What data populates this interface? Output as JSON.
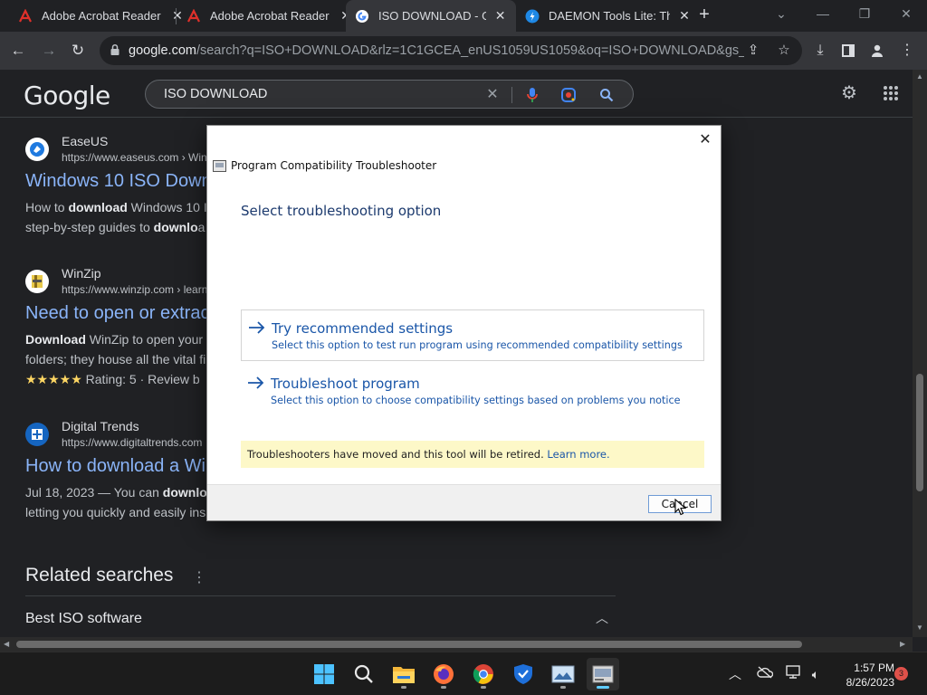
{
  "browser": {
    "tabs": [
      {
        "title": "Adobe Acrobat Reader",
        "icon": "adobe-icon"
      },
      {
        "title": "Adobe Acrobat Reader",
        "icon": "adobe-icon"
      },
      {
        "title": "ISO DOWNLOAD - Goo",
        "icon": "google-icon"
      },
      {
        "title": "DAEMON Tools Lite: Th",
        "icon": "daemon-tools-icon"
      }
    ],
    "active_tab": 2,
    "url_host": "google.com",
    "url_path": "/search?q=ISO+DOWNLOAD&rlz=1C1GCEA_enUS1059US1059&oq=ISO+DOWNLOAD&gs_lcr..."
  },
  "google": {
    "logo": "Google",
    "query": "ISO DOWNLOAD"
  },
  "results": [
    {
      "site": "EaseUS",
      "url": "https://www.easeus.com › Win",
      "title": "Windows 10 ISO Down",
      "snippet_l1_pre": "How to ",
      "snippet_l1_bold": "download",
      "snippet_l1_post": " Windows 10 I",
      "snippet_l2_pre": "step-by-step guides to ",
      "snippet_l2_bold": "downlo",
      "snippet_l2_post": "a"
    },
    {
      "site": "WinZip",
      "url": "https://www.winzip.com › learn",
      "title": "Need to open or extrac",
      "snippet_l1_pre": "",
      "snippet_l1_bold": "Download",
      "snippet_l1_post": " WinZip to open your",
      "snippet_l2_pre": "folders; they house all the vital fi",
      "snippet_l2_bold": "",
      "snippet_l2_post": "",
      "stars": "★★★★★",
      "rating": " Rating: 5 · Review b"
    },
    {
      "site": "Digital Trends",
      "url": "https://www.digitaltrends.com",
      "title": "How to download a Wi",
      "snippet_l1_pre": "Jul 18, 2023 — You can ",
      "snippet_l1_bold": "downlo",
      "snippet_l1_post": "",
      "snippet_l2_pre": "letting you quickly and easily ins",
      "snippet_l2_bold": "",
      "snippet_l2_post": ""
    }
  ],
  "related": {
    "title": "Related searches",
    "items": [
      "Best ISO software"
    ]
  },
  "dialog": {
    "title": "Program Compatibility Troubleshooter",
    "heading": "Select troubleshooting option",
    "options": [
      {
        "title": "Try recommended settings",
        "desc": "Select this option to test run program using recommended compatibility settings"
      },
      {
        "title": "Troubleshoot program",
        "desc": "Select this option to choose compatibility settings based on problems you notice"
      }
    ],
    "notice_text": "Troubleshooters have moved and this tool will be retired. ",
    "notice_link": "Learn more.",
    "cancel_label": "Cancel"
  },
  "taskbar": {
    "apps": [
      "windows-start-icon",
      "search-icon",
      "file-explorer-icon",
      "firefox-icon",
      "chrome-icon",
      "security-shield-icon",
      "photo-app-icon",
      "troubleshooter-icon"
    ],
    "time": "1:57 PM",
    "date": "8/26/2023",
    "notification_count": "3"
  }
}
